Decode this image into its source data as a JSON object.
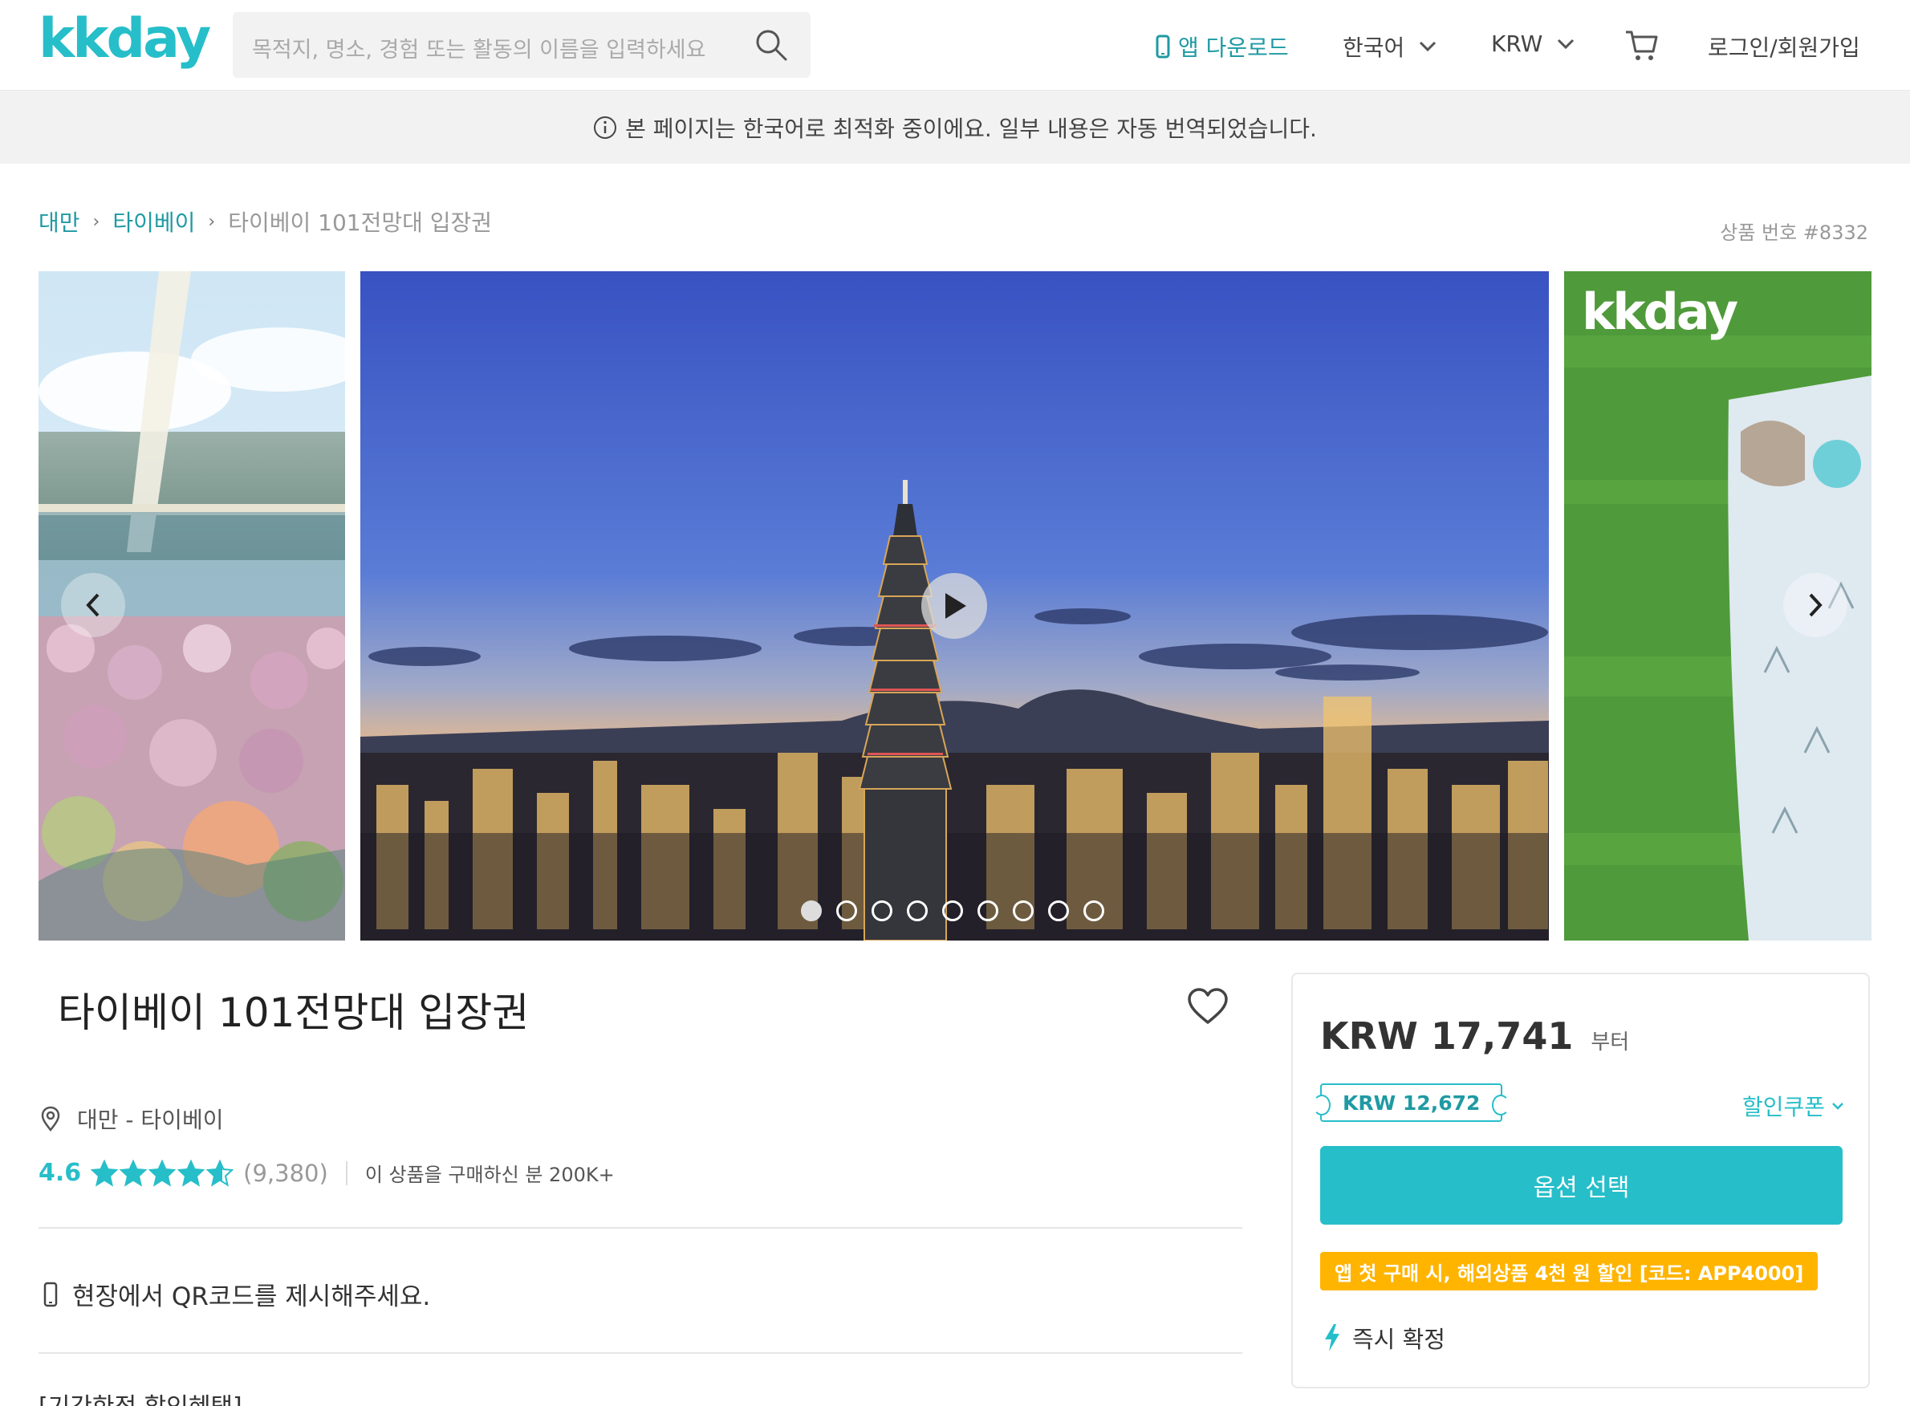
{
  "header": {
    "logo": "kkday",
    "search_placeholder": "목적지, 명소, 경험 또는 활동의 이름을 입력하세요",
    "app_download": "앱 다운로드",
    "language": "한국어",
    "currency": "KRW",
    "login": "로그인/회원가입"
  },
  "notice": {
    "text": "본 페이지는 한국어로 최적화 중이에요. 일부 내용은 자동 번역되었습니다."
  },
  "breadcrumb": {
    "items": [
      "대만",
      "타이베이",
      "타이베이 101전망대 입장권"
    ]
  },
  "product_number": "상품 번호 #8332",
  "gallery": {
    "right_logo": "kkday",
    "dot_count": 9,
    "active_dot": 0
  },
  "product": {
    "title": "타이베이 101전망대 입장권",
    "location": "대만 - 타이베이",
    "rating": "4.6",
    "rating_value": 4.6,
    "review_count": "(9,380)",
    "buyers": "이 상품을 구매하신 분 200K+",
    "qr_notice": "현장에서 QR코드를 제시해주세요.",
    "promo_heading": "[기간한정 할인혜택]"
  },
  "booking": {
    "price": "KRW 17,741",
    "price_suffix": "부터",
    "coupon_price": "KRW 12,672",
    "coupon_link": "할인쿠폰",
    "select_button": "옵션 선택",
    "app_promo": "앱 첫 구매 시, 해외상품 4천 원 할인 [코드: APP4000]",
    "instant": "즉시 확정"
  },
  "colors": {
    "brand": "#26bec9",
    "brand_dark": "#1f9aa3",
    "promo": "#ffb400"
  }
}
